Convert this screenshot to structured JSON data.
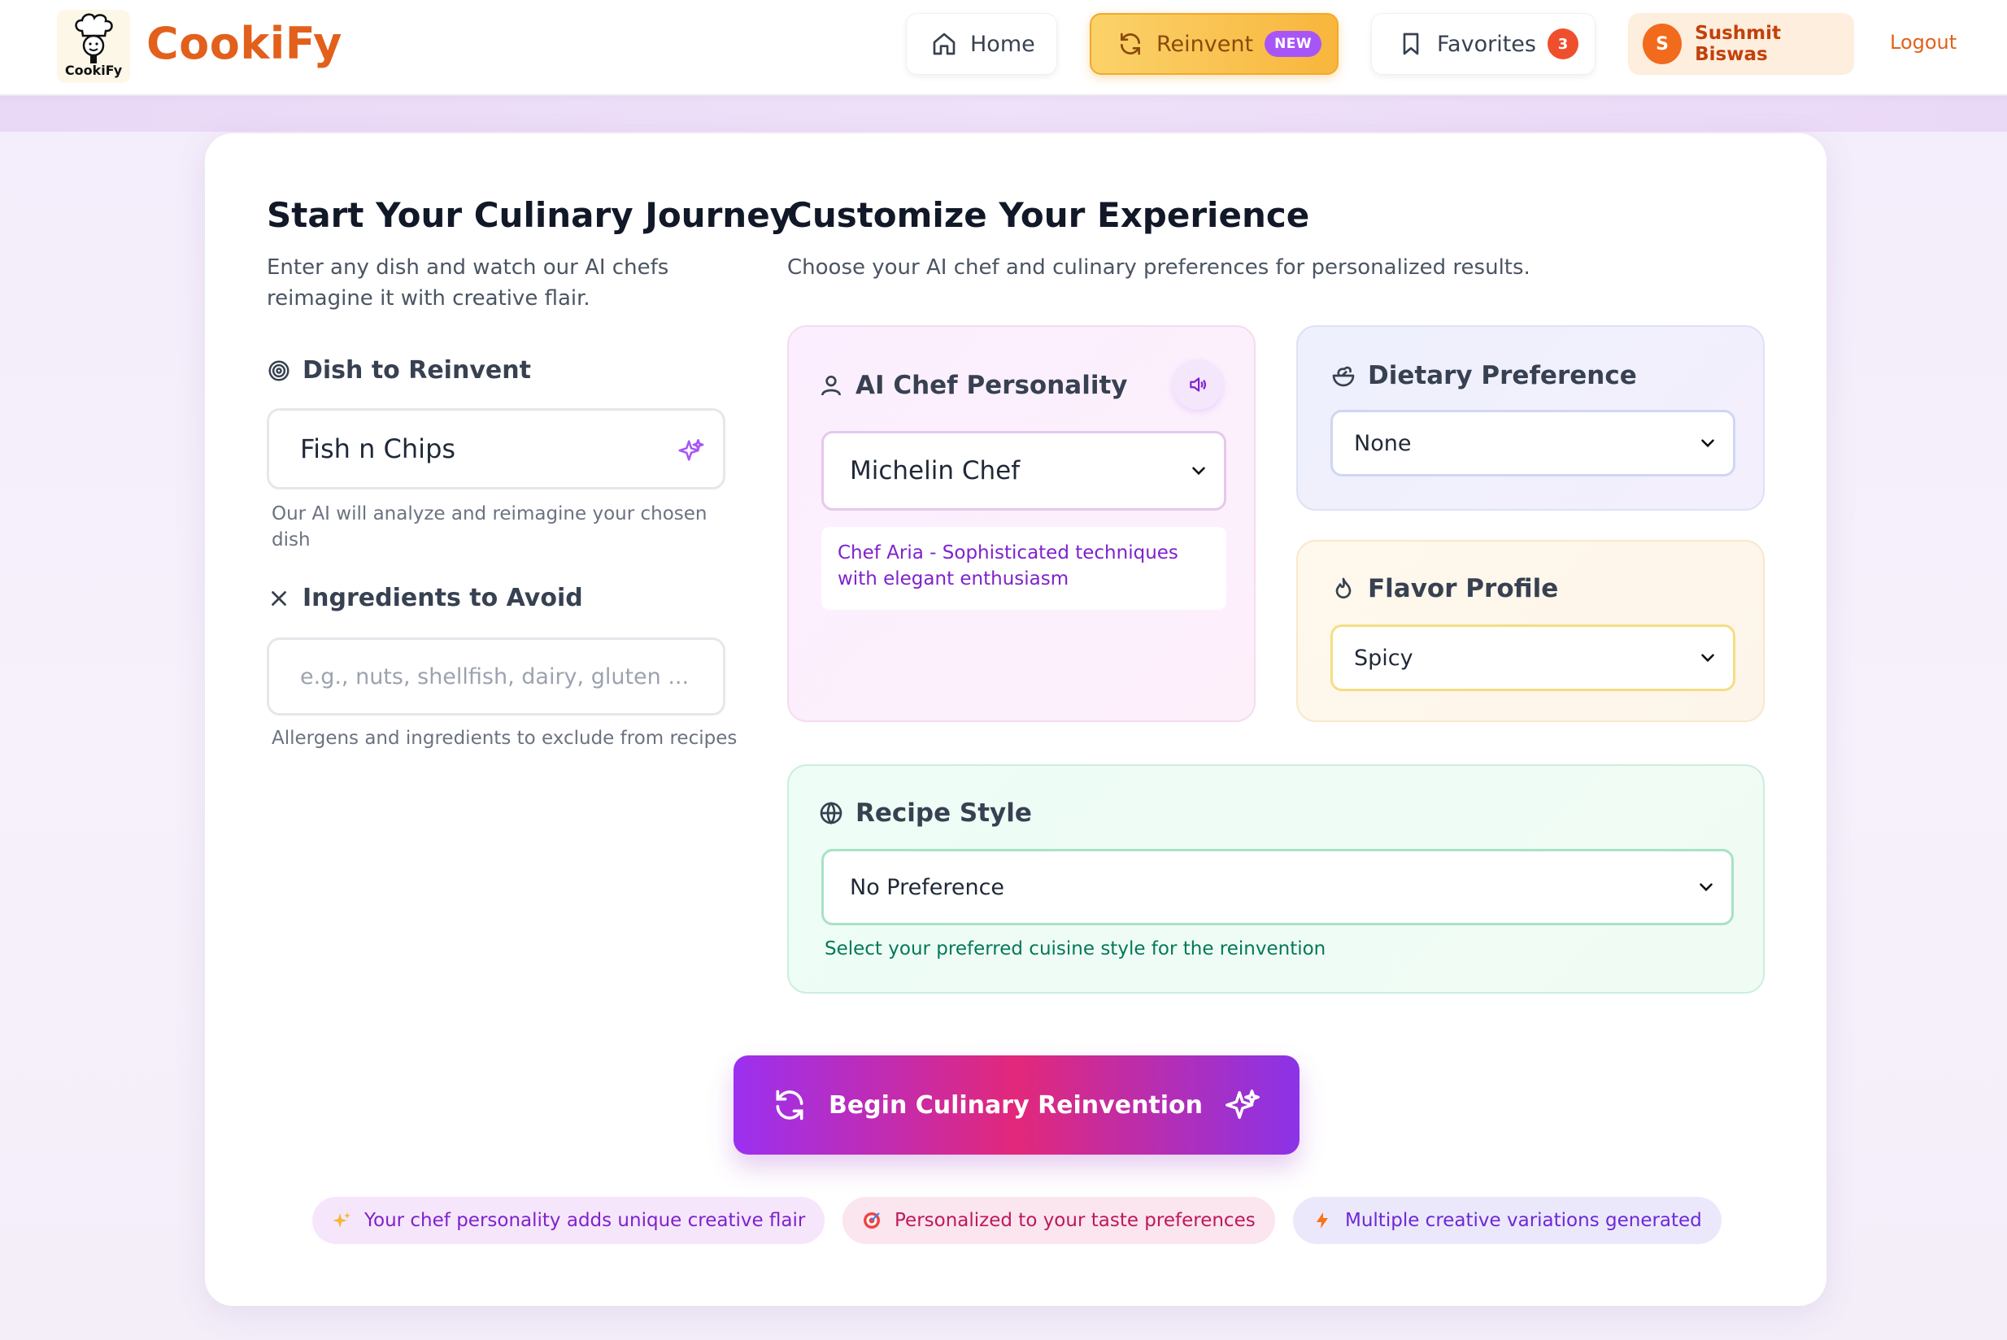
{
  "brand": {
    "logo_caption": "CookiFy",
    "name": "CookiFy",
    "color": "#e2601c"
  },
  "nav": {
    "home": "Home",
    "reinvent": "Reinvent",
    "reinvent_badge": "NEW",
    "favorites": "Favorites",
    "favorites_count": "3",
    "user_initial": "S",
    "user_name": "Sushmit Biswas",
    "logout": "Logout"
  },
  "left": {
    "title": "Start Your Culinary Journey",
    "subtitle": "Enter any dish and watch our AI chefs reimagine it with creative flair.",
    "dish_label": "Dish to Reinvent",
    "dish_value": "Fish n Chips",
    "dish_help": "Our AI will analyze and reimagine your chosen dish",
    "avoid_label": "Ingredients to Avoid",
    "avoid_placeholder": "e.g., nuts, shellfish, dairy, gluten ...",
    "avoid_help": "Allergens and ingredients to exclude from recipes"
  },
  "right": {
    "title": "Customize Your Experience",
    "subtitle": "Choose your AI chef and culinary preferences for personalized results.",
    "chef": {
      "label": "AI Chef Personality",
      "selected": "Michelin Chef",
      "description": "Chef Aria - Sophisticated techniques with elegant enthusiasm"
    },
    "diet": {
      "label": "Dietary Preference",
      "selected": "None"
    },
    "flavor": {
      "label": "Flavor Profile",
      "selected": "Spicy"
    },
    "style": {
      "label": "Recipe Style",
      "selected": "No Preference",
      "help": "Select your preferred cuisine style for the reinvention"
    }
  },
  "cta": {
    "label": "Begin Culinary Reinvention"
  },
  "chips": [
    {
      "icon": "sparkles-icon",
      "text": "Your chef personality adds unique creative flair"
    },
    {
      "icon": "target-icon",
      "text": "Personalized to your taste preferences"
    },
    {
      "icon": "lightning-icon",
      "text": "Multiple creative variations generated"
    }
  ],
  "colors": {
    "accent_purple": "#a855f7",
    "accent_orange": "#e2601c",
    "cta_pink": "#e2287a"
  }
}
